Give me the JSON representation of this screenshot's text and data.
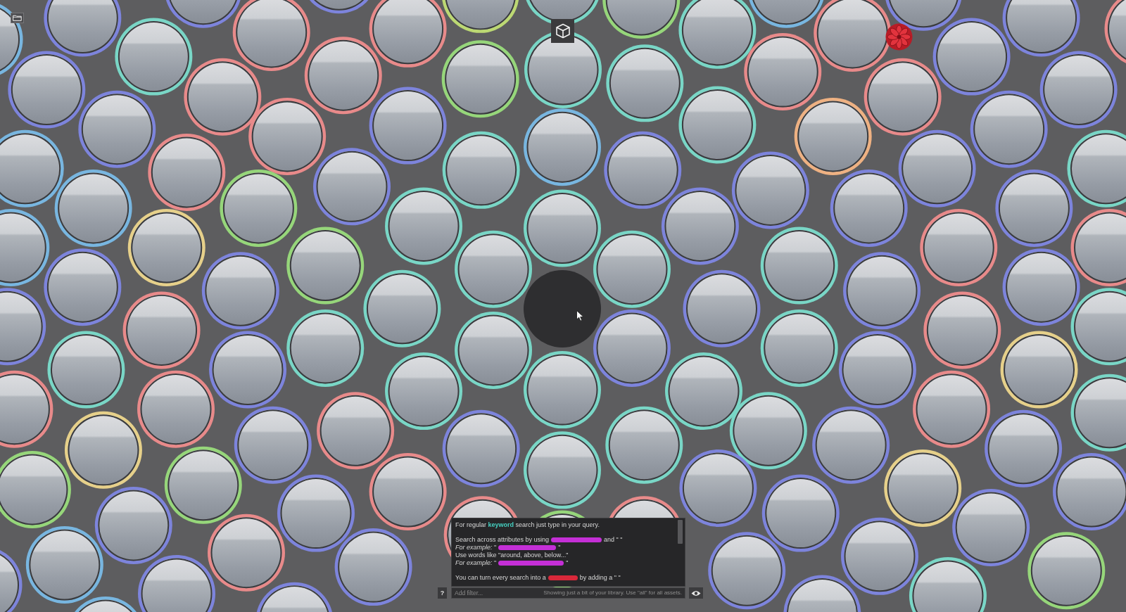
{
  "canvas": {
    "bubbles": [
      {
        "kind": "asset",
        "color": "#78b6e0"
      },
      {
        "kind": "asset",
        "color": "#7d84dc"
      },
      {
        "kind": "asset",
        "color": "#7d84dc"
      },
      {
        "kind": "asset",
        "color": "#e88a8a"
      },
      {
        "kind": "asset",
        "color": "#7d84dc"
      },
      {
        "kind": "asset",
        "color": "#e88a8a"
      },
      {
        "kind": "asset",
        "color": "#bcd873"
      },
      {
        "kind": "asset",
        "color": "#79d6c6"
      },
      {
        "kind": "asset",
        "color": "#96d67a"
      },
      {
        "kind": "asset",
        "color": "#79d6c6"
      },
      {
        "kind": "asset",
        "color": "#78b6e0"
      },
      {
        "kind": "asset",
        "color": "#e88a8a"
      },
      {
        "kind": "asset",
        "color": "#7d84dc"
      },
      {
        "kind": "asset",
        "color": "#7d84dc"
      },
      {
        "kind": "asset",
        "color": "#e88a8a"
      },
      {
        "kind": "asset",
        "color": "#7d84dc"
      },
      {
        "kind": "asset",
        "color": "#79d6c6"
      },
      {
        "kind": "asset",
        "color": "#e88a8a"
      },
      {
        "kind": "asset",
        "color": "#e88a8a"
      },
      {
        "kind": "asset",
        "color": "#96d67a"
      },
      {
        "kind": "asset",
        "color": "#79d6c6"
      },
      {
        "kind": "asset",
        "color": "#79d6c6"
      },
      {
        "kind": "asset",
        "color": "#e88a8a"
      },
      {
        "kind": "asset",
        "color": "#e88a8a"
      },
      {
        "kind": "asset",
        "color": "#7d84dc"
      },
      {
        "kind": "asset",
        "color": "#7d84dc"
      },
      {
        "kind": "asset",
        "color": "#7d84dc"
      },
      {
        "kind": "asset",
        "color": "#e88a8a"
      },
      {
        "kind": "asset",
        "color": "#7d84dc"
      },
      {
        "kind": "asset",
        "color": "#79d6c6"
      },
      {
        "kind": "asset",
        "color": "#eeb182"
      },
      {
        "kind": "asset",
        "color": "#7d84dc"
      },
      {
        "kind": "asset",
        "color": "#78b6e0"
      },
      {
        "kind": "asset",
        "color": "#e88a8a"
      },
      {
        "kind": "asset",
        "color": "#79d6c6"
      },
      {
        "kind": "asset",
        "color": "#78b6e0"
      },
      {
        "kind": "asset",
        "color": "#7d84dc"
      },
      {
        "kind": "asset",
        "color": "#7d84dc"
      },
      {
        "kind": "asset",
        "color": "#79d6c6"
      },
      {
        "kind": "asset",
        "color": "#78b6e0"
      },
      {
        "kind": "asset",
        "color": "#7d84dc"
      },
      {
        "kind": "asset",
        "color": "#96d67a"
      },
      {
        "kind": "asset",
        "color": "#7d84dc"
      },
      {
        "kind": "asset",
        "color": "#7d84dc"
      },
      {
        "kind": "asset",
        "color": "#7d84dc"
      },
      {
        "kind": "asset",
        "color": "#79d6c6"
      },
      {
        "kind": "asset",
        "color": "#79d6c6"
      },
      {
        "kind": "asset",
        "color": "#7d84dc"
      },
      {
        "kind": "asset",
        "color": "#78b6e0"
      },
      {
        "kind": "asset",
        "color": "#e6d08a"
      },
      {
        "kind": "asset",
        "color": "#96d67a"
      },
      {
        "kind": "asset",
        "color": "#79d6c6"
      },
      {
        "kind": "asset",
        "color": "#79d6c6"
      },
      {
        "kind": "asset",
        "color": "#79d6c6"
      },
      {
        "kind": "asset",
        "color": "#e88a8a"
      },
      {
        "kind": "asset",
        "color": "#e88a8a"
      },
      {
        "kind": "asset",
        "color": "#7d84dc"
      },
      {
        "kind": "asset",
        "color": "#7d84dc"
      },
      {
        "kind": "asset",
        "color": "#7d84dc"
      },
      {
        "kind": "asset",
        "color": "#7d84dc"
      },
      {
        "kind": "asset",
        "color": "#7d84dc"
      },
      {
        "kind": "asset",
        "color": "#e88a8a"
      },
      {
        "kind": "asset",
        "color": "#79d6c6"
      },
      {
        "kind": "empty"
      },
      {
        "kind": "asset",
        "color": "#7d84dc"
      },
      {
        "kind": "asset",
        "color": "#e88a8a"
      },
      {
        "kind": "asset",
        "color": "#79d6c6"
      },
      {
        "kind": "asset",
        "color": "#79d6c6"
      },
      {
        "kind": "asset",
        "color": "#79d6c6"
      },
      {
        "kind": "asset",
        "color": "#7d84dc"
      },
      {
        "kind": "asset",
        "color": "#79d6c6"
      },
      {
        "kind": "asset",
        "color": "#79d6c6"
      },
      {
        "kind": "asset",
        "color": "#7d84dc"
      },
      {
        "kind": "asset",
        "color": "#7d84dc"
      },
      {
        "kind": "asset",
        "color": "#e6d08a"
      },
      {
        "kind": "asset",
        "color": "#79d6c6"
      },
      {
        "kind": "asset",
        "color": "#79d6c6"
      },
      {
        "kind": "asset",
        "color": "#79d6c6"
      },
      {
        "kind": "asset",
        "color": "#e88a8a"
      },
      {
        "kind": "asset",
        "color": "#e88a8a"
      },
      {
        "kind": "asset",
        "color": "#e88a8a"
      },
      {
        "kind": "asset",
        "color": "#79d6c6"
      },
      {
        "kind": "asset",
        "color": "#e6d08a"
      },
      {
        "kind": "asset",
        "color": "#7d84dc"
      },
      {
        "kind": "asset",
        "color": "#e88a8a"
      },
      {
        "kind": "asset",
        "color": "#7d84dc"
      },
      {
        "kind": "asset",
        "color": "#79d6c6"
      },
      {
        "kind": "asset",
        "color": "#79d6c6"
      },
      {
        "kind": "asset",
        "color": "#7d84dc"
      },
      {
        "kind": "asset",
        "color": "#7d84dc"
      },
      {
        "kind": "asset",
        "color": "#79d6c6"
      },
      {
        "kind": "asset",
        "color": "#96d67a"
      },
      {
        "kind": "asset",
        "color": "#96d67a"
      },
      {
        "kind": "asset",
        "color": "#e88a8a"
      },
      {
        "kind": "asset",
        "color": "#7d84dc"
      },
      {
        "kind": "asset",
        "color": "#e6d08a"
      },
      {
        "kind": "asset",
        "color": "#7d84dc"
      },
      {
        "kind": "asset",
        "color": "#7d84dc"
      },
      {
        "kind": "asset",
        "color": "#7d84dc"
      },
      {
        "kind": "asset",
        "color": "#7d84dc"
      },
      {
        "kind": "asset",
        "color": "#7d84dc"
      },
      {
        "kind": "asset",
        "color": "#e88a8a"
      },
      {
        "kind": "asset",
        "color": "#96d67a"
      },
      {
        "kind": "asset",
        "color": "#e88a8a"
      },
      {
        "kind": "asset",
        "color": "#7d84dc"
      },
      {
        "kind": "asset",
        "color": "#78b6e0"
      },
      {
        "kind": "asset",
        "color": "#e88a8a"
      },
      {
        "kind": "asset",
        "color": "#7d84dc"
      },
      {
        "kind": "asset",
        "color": "#7d84dc"
      },
      {
        "kind": "asset",
        "color": "#7d84dc"
      },
      {
        "kind": "asset",
        "color": "#96d67a"
      },
      {
        "kind": "asset",
        "color": "#79d6c6"
      },
      {
        "kind": "asset",
        "color": "#7d84dc"
      },
      {
        "kind": "asset",
        "color": "#78b6e0"
      },
      {
        "kind": "asset",
        "color": "#7d84dc"
      },
      {
        "kind": "asset",
        "color": "#7d84dc"
      }
    ]
  },
  "help_popup": {
    "paragraphs": [
      {
        "lines": [
          {
            "parts": [
              {
                "kind": "text",
                "text": "For regular **keyword** search just type in your query."
              }
            ]
          }
        ]
      },
      {
        "lines": [
          {
            "parts": [
              {
                "kind": "text",
                "text": "Search across attributes by using"
              },
              {
                "kind": "blurred",
                "color": "#c42fd6"
              },
              {
                "kind": "text",
                "text": "and \" \""
              }
            ]
          },
          {
            "parts": [
              {
                "kind": "text",
                "text": "*For example:* \""
              },
              {
                "kind": "blurred",
                "color": "#c42fd6"
              },
              {
                "kind": "text",
                "text": "\""
              }
            ]
          },
          {
            "parts": [
              {
                "kind": "text",
                "text": "Use words like \"around, above, below...\""
              }
            ]
          },
          {
            "parts": [
              {
                "kind": "text",
                "text": "*For example:* \""
              },
              {
                "kind": "blurred",
                "color": "#c42fd6"
              },
              {
                "kind": "text",
                "text": "\""
              }
            ]
          }
        ]
      },
      {
        "lines": [
          {
            "parts": [
              {
                "kind": "text",
                "text": "You can turn every search into a"
              },
              {
                "kind": "blurred",
                "color": "#d8283a"
              },
              {
                "kind": "text",
                "text": "by adding a \" \""
              }
            ]
          }
        ]
      }
    ]
  },
  "filter_bar": {
    "help_button": "?",
    "placeholder": "Add filter...",
    "hint": "Showing just a bit of your library. Use \"all\" for all assets."
  }
}
